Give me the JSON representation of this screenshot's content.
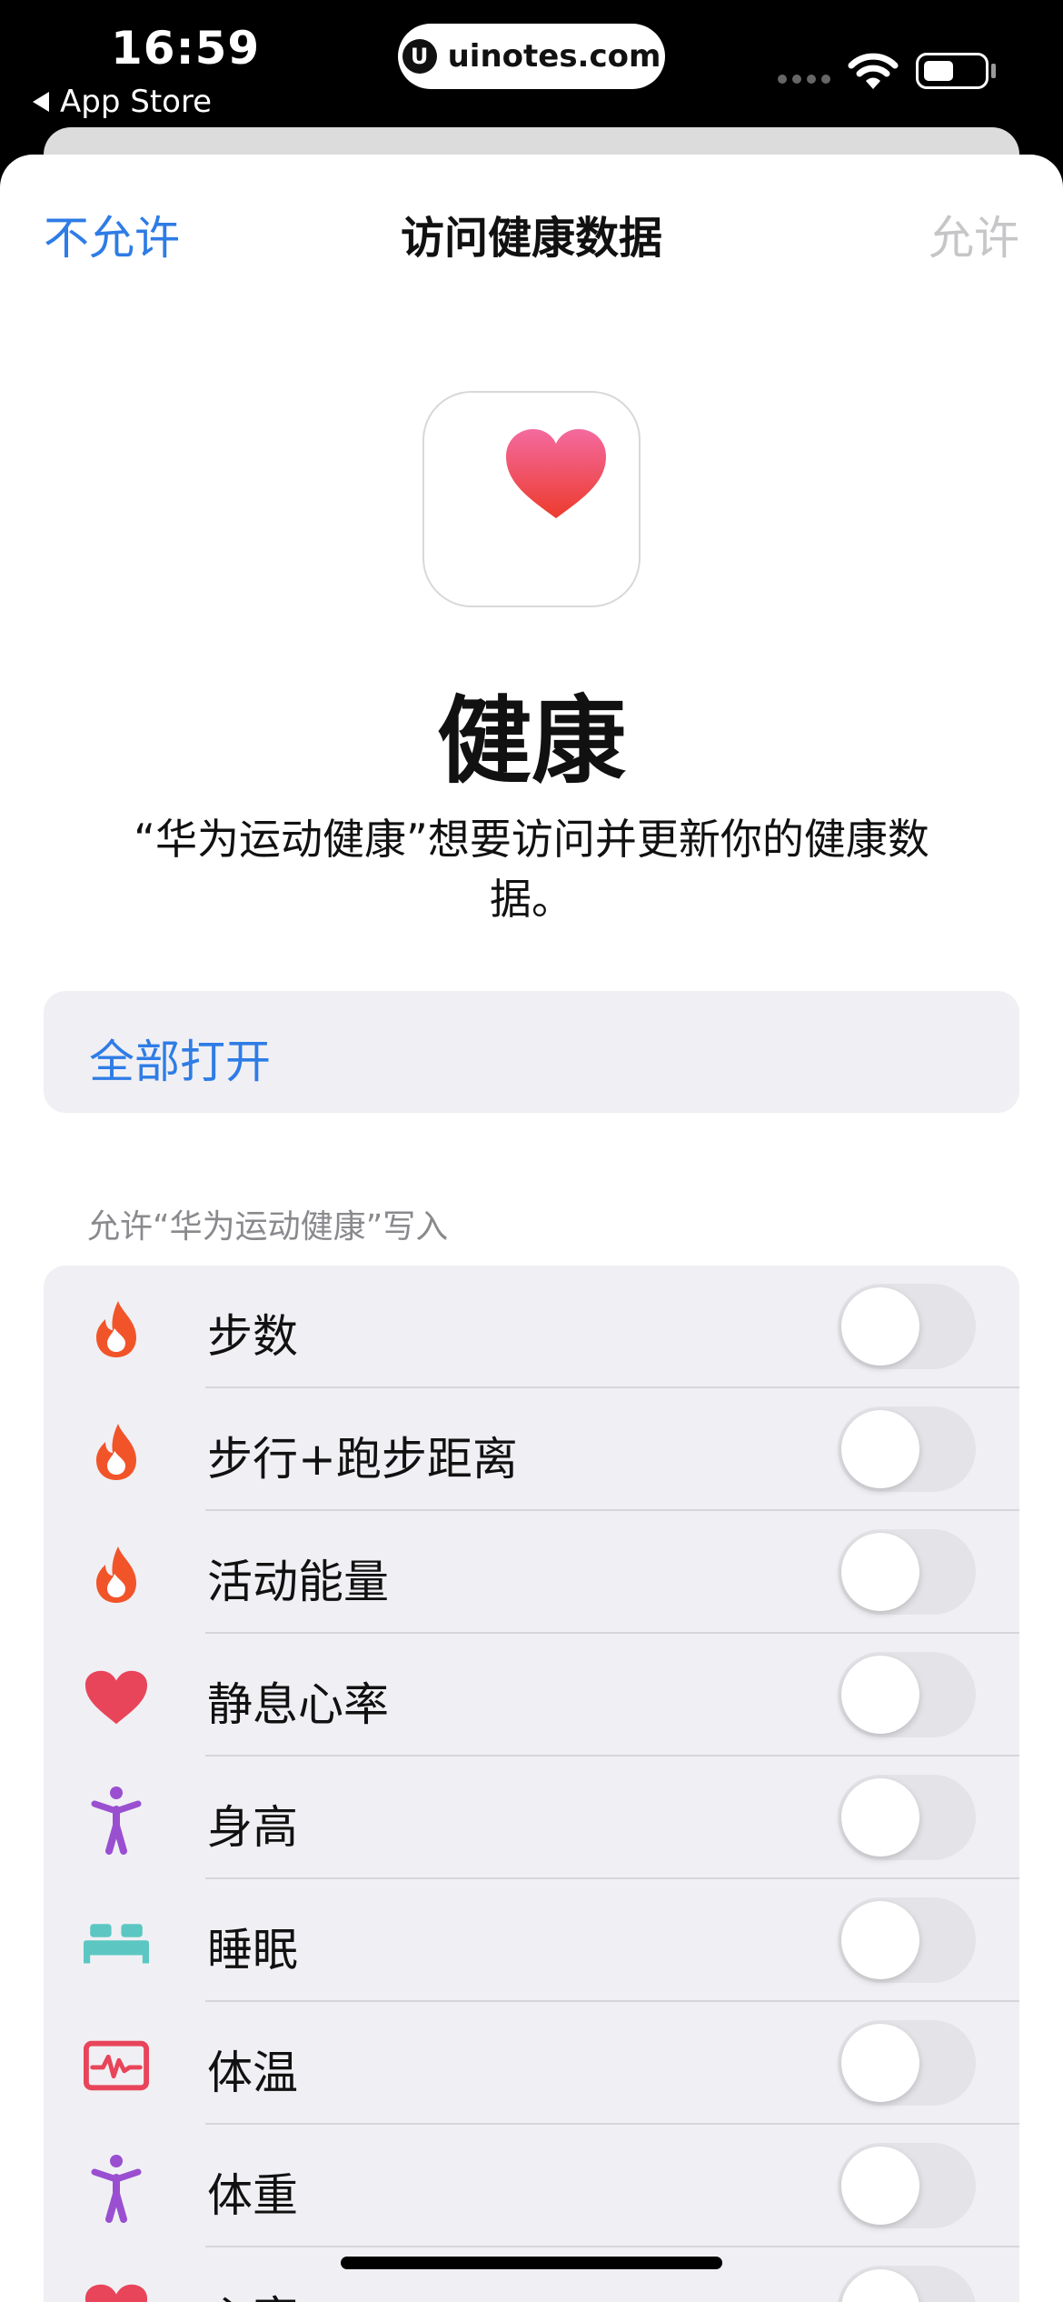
{
  "status_bar": {
    "time": "16:59",
    "back_label": "App Store",
    "url": "uinotes.com",
    "url_logo": "U",
    "signal_icon": "signal-dots-icon",
    "wifi_icon": "wifi-icon",
    "battery_icon": "battery-icon"
  },
  "nav": {
    "left": "不允许",
    "title": "访问健康数据",
    "right": "允许"
  },
  "app": {
    "icon": "health-heart-icon",
    "name": "健康",
    "description": "“华为运动健康”想要访问并更新你的健康数据。"
  },
  "turn_all": "全部打开",
  "section_header": "允许“华为运动健康”写入",
  "items": [
    {
      "label": "步数",
      "icon": "flame-icon",
      "on": false
    },
    {
      "label": "步行+跑步距离",
      "icon": "flame-icon",
      "on": false
    },
    {
      "label": "活动能量",
      "icon": "flame-icon",
      "on": false
    },
    {
      "label": "静息心率",
      "icon": "heart-icon",
      "on": false
    },
    {
      "label": "身高",
      "icon": "body-figure-icon",
      "on": false
    },
    {
      "label": "睡眠",
      "icon": "bed-icon",
      "on": false
    },
    {
      "label": "体温",
      "icon": "thermometer-wave-icon",
      "on": false
    },
    {
      "label": "体重",
      "icon": "body-figure-icon",
      "on": false
    },
    {
      "label": "心率",
      "icon": "heart-icon",
      "on": false
    }
  ],
  "colors": {
    "accent": "#2e7ce6",
    "disabled": "#c6c6c8",
    "flame": "#f2542a",
    "heart": "#e8455a",
    "figure": "#9a4fd1",
    "bed": "#5cc7c2",
    "vitals": "#e8455a"
  }
}
